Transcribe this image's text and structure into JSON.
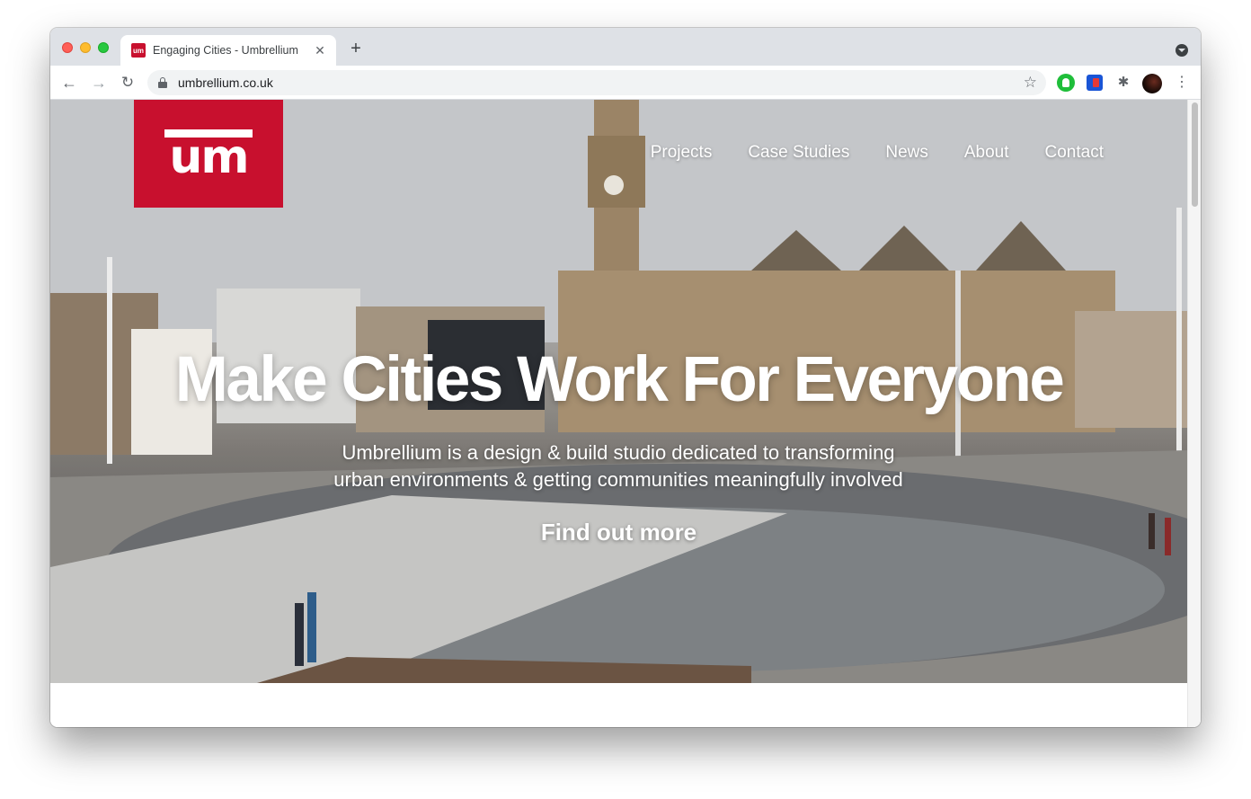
{
  "browser": {
    "tab_title": "Engaging Cities - Umbrellium",
    "favicon_text": "um",
    "url": "umbrellium.co.uk",
    "icons": {
      "back": "arrow-left-icon",
      "forward": "arrow-right-icon",
      "reload": "reload-icon",
      "lock": "lock-icon",
      "bookmark": "star-icon",
      "extensions": "puzzle-icon",
      "menu": "kebab-menu-icon",
      "tab_close": "close-icon",
      "new_tab": "plus-icon",
      "tab_search": "chevron-down-icon"
    },
    "glyphs": {
      "back": "←",
      "forward": "→",
      "reload": "↻",
      "star": "☆",
      "close": "✕",
      "plus": "+",
      "puzzle": "✱",
      "menu": "⋮"
    }
  },
  "site": {
    "logo_text": "um",
    "brand_color": "#c8102e",
    "nav": [
      "Projects",
      "Case Studies",
      "News",
      "About",
      "Contact"
    ],
    "hero": {
      "title": "Make Cities Work For Everyone",
      "subtitle_line1": "Umbrellium is a design & build studio dedicated to transforming",
      "subtitle_line2": "urban environments & getting communities meaningfully involved",
      "cta": "Find out more"
    }
  }
}
